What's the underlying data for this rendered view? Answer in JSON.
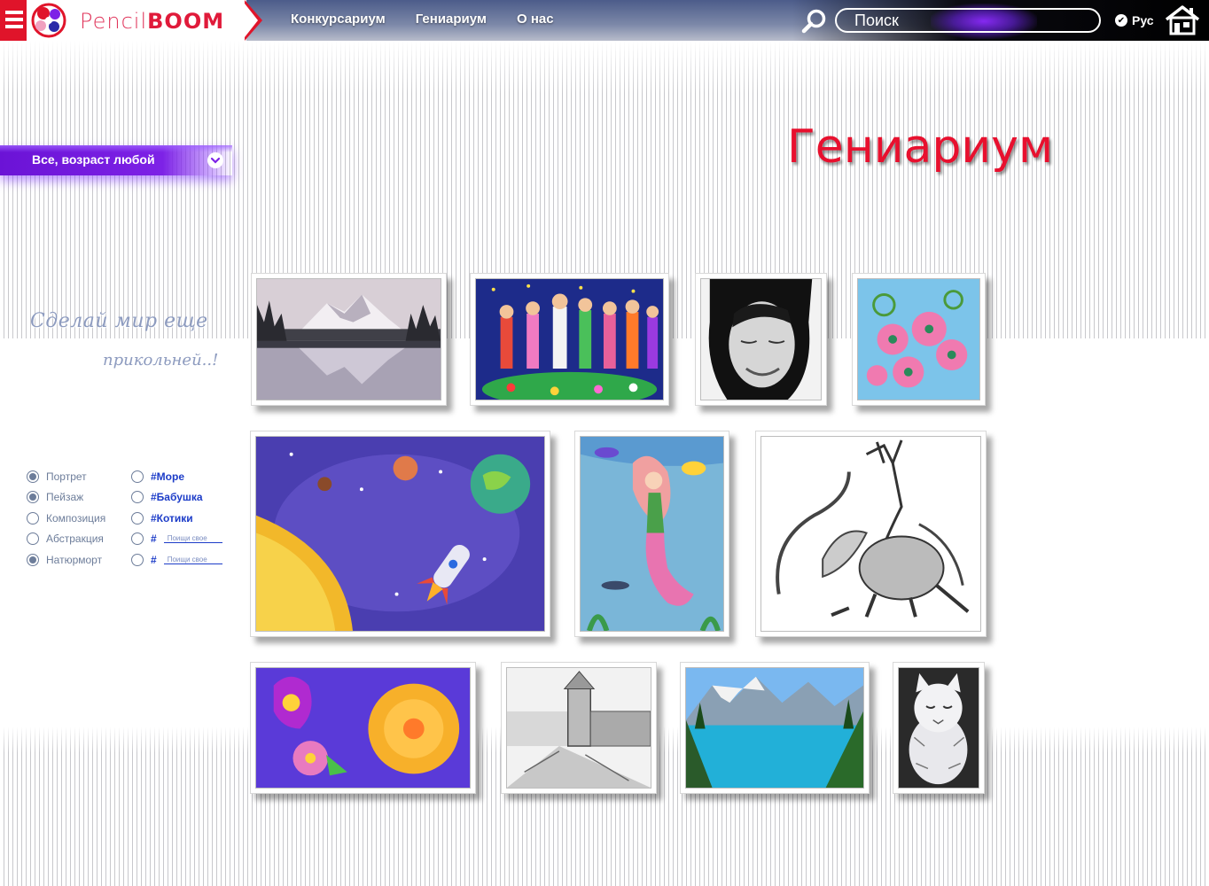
{
  "header": {
    "logo": {
      "light": "Pencil",
      "bold": "BOOM"
    },
    "nav": [
      "Конкурсариум",
      "Гениариум",
      "О нас"
    ],
    "search_placeholder": "Поиск",
    "language": "Рус",
    "icons": [
      "menu-icon",
      "search-icon",
      "check-icon",
      "home-icon"
    ]
  },
  "filter_bar": {
    "label": "Все, возраст любой"
  },
  "page_title": "Гениариум",
  "slogan": {
    "line1": "Сделай мир еще",
    "line2": "прикольней..!"
  },
  "categories": [
    {
      "label": "Портрет",
      "checked": true
    },
    {
      "label": "Пейзаж",
      "checked": true
    },
    {
      "label": "Композиция",
      "checked": false
    },
    {
      "label": "Абстракция",
      "checked": false
    },
    {
      "label": "Натюрморт",
      "checked": true
    }
  ],
  "tags": [
    {
      "label": "#Море",
      "checked": false
    },
    {
      "label": "#Бабушка",
      "checked": false
    },
    {
      "label": "#Котики",
      "checked": false
    }
  ],
  "custom_tags": [
    {
      "prefix": "#",
      "placeholder": "Поищи свое"
    },
    {
      "prefix": "#",
      "placeholder": "Поищи свое"
    }
  ],
  "gallery": [
    "mountain-lake-photo",
    "children-drawing",
    "woman-portrait",
    "paper-flowers",
    "space-painting",
    "mermaid-drawing",
    "dragon-sketch",
    "paper-roses",
    "monastery-sketch",
    "mountain-lake-turquoise",
    "cat-drawing"
  ],
  "colors": {
    "accent_red": "#e8102e",
    "accent_purple": "#7d22e6",
    "tag_blue": "#1c3cc8",
    "label_gray": "#6d7d9a"
  }
}
